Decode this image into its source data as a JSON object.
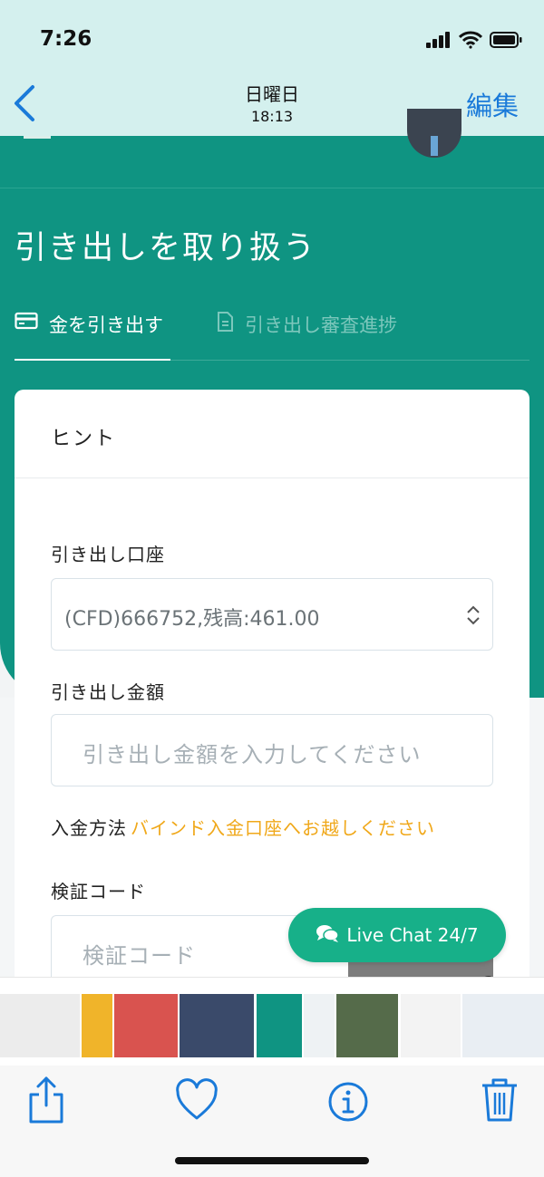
{
  "status_bar": {
    "time": "7:26"
  },
  "photos_nav": {
    "title": "日曜日",
    "subtitle": "18:13",
    "edit_label": "編集"
  },
  "app": {
    "page_title": "引き出しを取り扱う",
    "tabs": [
      {
        "label": "金を引き出す",
        "icon": "card-icon"
      },
      {
        "label": "引き出し審査進捗",
        "icon": "document-icon"
      }
    ],
    "card": {
      "hint_label": "ヒント",
      "account_label": "引き出し口座",
      "account_value": "(CFD)666752,残高:461.00",
      "amount_label": "引き出し金額",
      "amount_placeholder": "引き出し金額を入力してください",
      "method_label": "入金方法",
      "method_link": "バインド入金口座へお越しください",
      "code_label": "検証コード",
      "code_placeholder": "検証コード"
    },
    "live_chat_label": "Live Chat 24/7"
  },
  "colors": {
    "teal": "#0f9482",
    "accent_blue": "#1a7ad9",
    "link_orange": "#f0a81a",
    "chat_green": "#17b089"
  }
}
